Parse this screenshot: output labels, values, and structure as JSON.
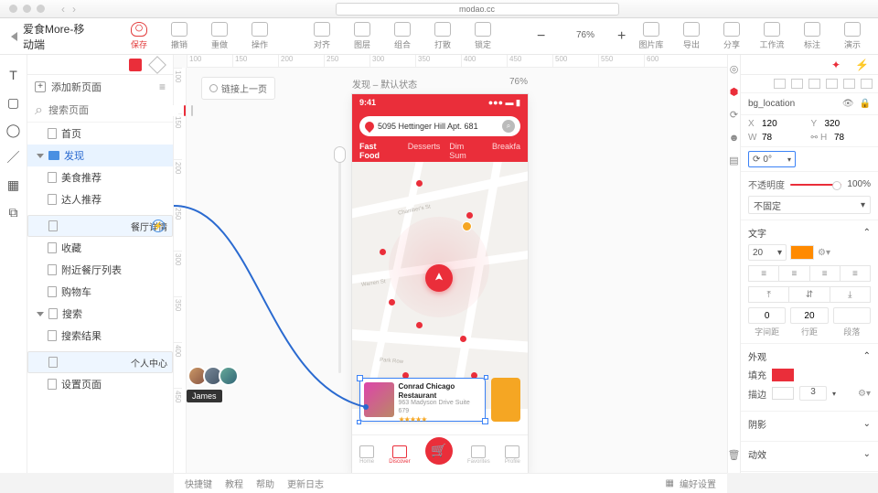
{
  "browser": {
    "url": "modao.cc"
  },
  "project": {
    "name": "爱食More-移动端"
  },
  "toolbar": {
    "save": "保存",
    "undo": "撤销",
    "redo": "重做",
    "operate": "操作",
    "align": "对齐",
    "layer": "图层",
    "group": "组合",
    "ungroup": "打散",
    "lock": "锁定",
    "zoom_pct": "76%",
    "image_lib": "图片库",
    "export": "导出",
    "share": "分享",
    "workflow": "工作流",
    "annotate": "标注",
    "preview": "演示"
  },
  "pages": {
    "add": "添加新页面",
    "search_ph": "搜索页面",
    "tree": [
      {
        "label": "首页",
        "d": 1
      },
      {
        "label": "发现",
        "d": 0,
        "folder": true,
        "active": true
      },
      {
        "label": "美食推荐",
        "d": 1
      },
      {
        "label": "达人推荐",
        "d": 1
      },
      {
        "label": "餐厅详情",
        "d": 1,
        "sel": true
      },
      {
        "label": "收藏",
        "d": 1
      },
      {
        "label": "附近餐厅列表",
        "d": 1
      },
      {
        "label": "购物车",
        "d": 1
      },
      {
        "label": "搜索",
        "d": 0,
        "caret": true
      },
      {
        "label": "搜索结果",
        "d": 1
      },
      {
        "label": "个人中心",
        "d": 1,
        "hl": true
      },
      {
        "label": "设置页面",
        "d": 1
      }
    ]
  },
  "canvas": {
    "chip": "链接上一页",
    "screen_title": "发现 – 默认状态",
    "screen_zoom": "76%",
    "avatar_tooltip": "James"
  },
  "mock": {
    "time": "9:41",
    "address": "5095 Hettinger Hill Apt. 681",
    "cats": [
      "Fast Food",
      "Desserts",
      "Dim Sum",
      "Breakfa"
    ],
    "card_title": "Conrad Chicago Restaurant",
    "card_sub": "963 Madyson Drive Suite 679",
    "stars": "★★★★★",
    "tabs": [
      "Home",
      "Discover",
      "",
      "Favorites",
      "Profile"
    ]
  },
  "inspector": {
    "layer_name": "bg_location",
    "x_lb": "X",
    "x": "120",
    "y_lb": "Y",
    "y": "320",
    "w_lb": "W",
    "w": "78",
    "h_lb": "H",
    "h": "78",
    "rot": "0°",
    "opacity_lb": "不透明度",
    "opacity": "100%",
    "pin": "不固定",
    "text_hdr": "文字",
    "font_size": "20",
    "sp_char_lb": "字间距",
    "sp_char": "0",
    "sp_line_lb": "行距",
    "sp_line": "20",
    "sp_para_lb": "段落",
    "appearance_hdr": "外观",
    "fill_lb": "填充",
    "fill": "#ea2e3a",
    "stroke_lb": "描边",
    "stroke": "#ffffff",
    "stroke_w": "3",
    "shadow_hdr": "阴影",
    "fx_hdr": "动效",
    "swatch_color": "#ff8a00"
  },
  "bottom": {
    "shortcuts": "快捷键",
    "tutorial": "教程",
    "help": "帮助",
    "changelog": "更新日志",
    "editset": "编好设置"
  }
}
